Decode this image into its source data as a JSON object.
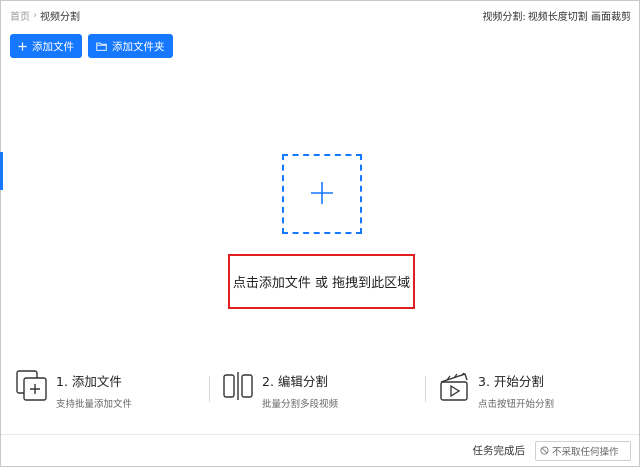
{
  "breadcrumb": {
    "home": "首页",
    "separator": "›",
    "current": "视频分割"
  },
  "tips": {
    "label": "视频分割:",
    "text": "视频长度切割 画面裁剪"
  },
  "toolbar": {
    "add_file": "添加文件",
    "add_folder": "添加文件夹"
  },
  "drop": {
    "text": "点击添加文件 或 拖拽到此区域"
  },
  "steps": [
    {
      "title": "1. 添加文件",
      "desc": "支持批量添加文件",
      "icon": "add-files-icon"
    },
    {
      "title": "2. 编辑分割",
      "desc": "批量分割多段视频",
      "icon": "split-icon"
    },
    {
      "title": "3. 开始分割",
      "desc": "点击按钮开始分割",
      "icon": "clapperboard-icon"
    }
  ],
  "footer": {
    "label": "任务完成后",
    "select_value": "不采取任何操作"
  },
  "colors": {
    "accent": "#1677ff",
    "highlight": "#e02020"
  }
}
